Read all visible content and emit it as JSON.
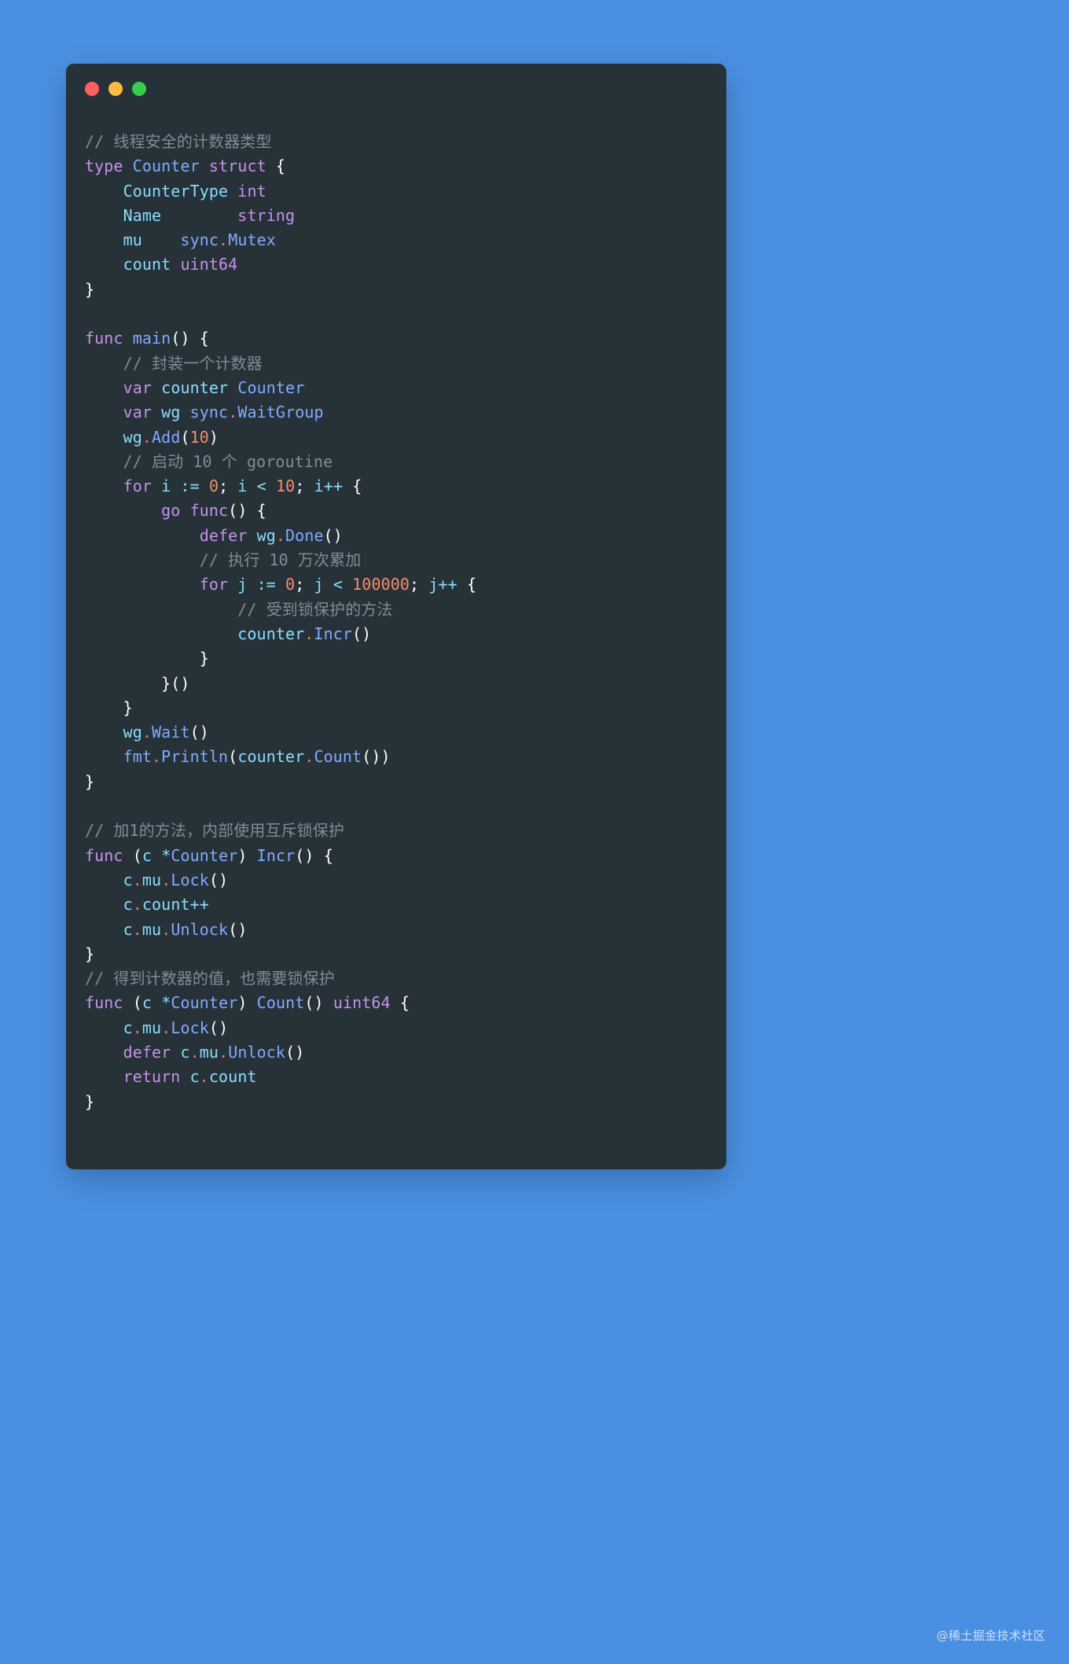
{
  "window": {
    "traffic_lights": [
      {
        "name": "close",
        "color": "#fc625d"
      },
      {
        "name": "minimize",
        "color": "#fdbc40"
      },
      {
        "name": "maximize",
        "color": "#35cd4b"
      }
    ],
    "background_color": "#263238",
    "page_background_color": "#4a90e2"
  },
  "watermark": {
    "text": "@稀土掘金技术社区"
  },
  "code": {
    "language": "go",
    "theme_colors": {
      "comment": "#7f8c98",
      "keyword": "#c792ea",
      "identifier": "#82aaff",
      "variable": "#89ddff",
      "number": "#f78c6c",
      "member_dot": "#f07178",
      "punctuation": "#ffffff",
      "foreground": "#d8dee9"
    },
    "lines": [
      "// 线程安全的计数器类型",
      "type Counter struct {",
      "    CounterType int",
      "    Name        string",
      "    mu    sync.Mutex",
      "    count uint64",
      "}",
      "",
      "func main() {",
      "    // 封装一个计数器",
      "    var counter Counter",
      "    var wg sync.WaitGroup",
      "    wg.Add(10)",
      "    // 启动 10 个 goroutine",
      "    for i := 0; i < 10; i++ {",
      "        go func() {",
      "            defer wg.Done()",
      "            // 执行 10 万次累加",
      "            for j := 0; j < 100000; j++ {",
      "                // 受到锁保护的方法",
      "                counter.Incr()",
      "            }",
      "        }()",
      "    }",
      "    wg.Wait()",
      "    fmt.Println(counter.Count())",
      "}",
      "",
      "// 加1的方法，内部使用互斥锁保护",
      "func (c *Counter) Incr() {",
      "    c.mu.Lock()",
      "    c.count++",
      "    c.mu.Unlock()",
      "}",
      "// 得到计数器的值，也需要锁保护",
      "func (c *Counter) Count() uint64 {",
      "    c.mu.Lock()",
      "    defer c.mu.Unlock()",
      "    return c.count",
      "}"
    ],
    "html": "<span class=\"cm\">// 线程安全的计数器类型</span>\n<span class=\"kw\">type</span> <span class=\"id\">Counter</span> <span class=\"kw\">struct</span> <span class=\"pn\">{</span>\n    <span class=\"vr\">CounterType</span> <span class=\"ty\">int</span>\n    <span class=\"vr\">Name</span>        <span class=\"ty\">string</span>\n    <span class=\"vr\">mu</span>    <span class=\"id\">sync</span><span class=\"dot-op\">.</span><span class=\"id\">Mutex</span>\n    <span class=\"vr\">count</span> <span class=\"ty\">uint64</span>\n<span class=\"pn\">}</span>\n\n<span class=\"kw\">func</span> <span class=\"id\">main</span><span class=\"pn\">()</span> <span class=\"pn\">{</span>\n    <span class=\"cm\">// 封装一个计数器</span>\n    <span class=\"kw\">var</span> <span class=\"vr\">counter</span> <span class=\"id\">Counter</span>\n    <span class=\"kw\">var</span> <span class=\"vr\">wg</span> <span class=\"id\">sync</span><span class=\"dot-op\">.</span><span class=\"id\">WaitGroup</span>\n    <span class=\"vr\">wg</span><span class=\"dot-op\">.</span><span class=\"id\">Add</span><span class=\"pn\">(</span><span class=\"num\">10</span><span class=\"pn\">)</span>\n    <span class=\"cm\">// 启动 10 个 goroutine</span>\n    <span class=\"kw\">for</span> <span class=\"vr\">i</span> <span class=\"op\">:=</span> <span class=\"num\">0</span><span class=\"pn\">;</span> <span class=\"vr\">i</span> <span class=\"op\">&lt;</span> <span class=\"num\">10</span><span class=\"pn\">;</span> <span class=\"vr\">i</span><span class=\"op\">++</span> <span class=\"pn\">{</span>\n        <span class=\"kw\">go</span> <span class=\"kw\">func</span><span class=\"pn\">()</span> <span class=\"pn\">{</span>\n            <span class=\"kw\">defer</span> <span class=\"vr\">wg</span><span class=\"dot-op\">.</span><span class=\"id\">Done</span><span class=\"pn\">()</span>\n            <span class=\"cm\">// 执行 10 万次累加</span>\n            <span class=\"kw\">for</span> <span class=\"vr\">j</span> <span class=\"op\">:=</span> <span class=\"num\">0</span><span class=\"pn\">;</span> <span class=\"vr\">j</span> <span class=\"op\">&lt;</span> <span class=\"num\">100000</span><span class=\"pn\">;</span> <span class=\"vr\">j</span><span class=\"op\">++</span> <span class=\"pn\">{</span>\n                <span class=\"cm\">// 受到锁保护的方法</span>\n                <span class=\"vr\">counter</span><span class=\"dot-op\">.</span><span class=\"id\">Incr</span><span class=\"pn\">()</span>\n            <span class=\"pn\">}</span>\n        <span class=\"pn\">}()</span>\n    <span class=\"pn\">}</span>\n    <span class=\"vr\">wg</span><span class=\"dot-op\">.</span><span class=\"id\">Wait</span><span class=\"pn\">()</span>\n    <span class=\"id\">fmt</span><span class=\"dot-op\">.</span><span class=\"id\">Println</span><span class=\"pn\">(</span><span class=\"vr\">counter</span><span class=\"dot-op\">.</span><span class=\"id\">Count</span><span class=\"pn\">())</span>\n<span class=\"pn\">}</span>\n\n<span class=\"cm\">// 加1的方法，内部使用互斥锁保护</span>\n<span class=\"kw\">func</span> <span class=\"pn\">(</span><span class=\"vr\">c</span> <span class=\"op\">*</span><span class=\"id\">Counter</span><span class=\"pn\">)</span> <span class=\"id\">Incr</span><span class=\"pn\">()</span> <span class=\"pn\">{</span>\n    <span class=\"vr\">c</span><span class=\"dot-op\">.</span><span class=\"vr\">mu</span><span class=\"dot-op\">.</span><span class=\"id\">Lock</span><span class=\"pn\">()</span>\n    <span class=\"vr\">c</span><span class=\"dot-op\">.</span><span class=\"vr\">count</span><span class=\"op\">++</span>\n    <span class=\"vr\">c</span><span class=\"dot-op\">.</span><span class=\"vr\">mu</span><span class=\"dot-op\">.</span><span class=\"id\">Unlock</span><span class=\"pn\">()</span>\n<span class=\"pn\">}</span>\n<span class=\"cm\">// 得到计数器的值，也需要锁保护</span>\n<span class=\"kw\">func</span> <span class=\"pn\">(</span><span class=\"vr\">c</span> <span class=\"op\">*</span><span class=\"id\">Counter</span><span class=\"pn\">)</span> <span class=\"id\">Count</span><span class=\"pn\">()</span> <span class=\"ty\">uint64</span> <span class=\"pn\">{</span>\n    <span class=\"vr\">c</span><span class=\"dot-op\">.</span><span class=\"vr\">mu</span><span class=\"dot-op\">.</span><span class=\"id\">Lock</span><span class=\"pn\">()</span>\n    <span class=\"kw\">defer</span> <span class=\"vr\">c</span><span class=\"dot-op\">.</span><span class=\"vr\">mu</span><span class=\"dot-op\">.</span><span class=\"id\">Unlock</span><span class=\"pn\">()</span>\n    <span class=\"kw\">return</span> <span class=\"vr\">c</span><span class=\"dot-op\">.</span><span class=\"vr\">count</span>\n<span class=\"pn\">}</span>"
  }
}
